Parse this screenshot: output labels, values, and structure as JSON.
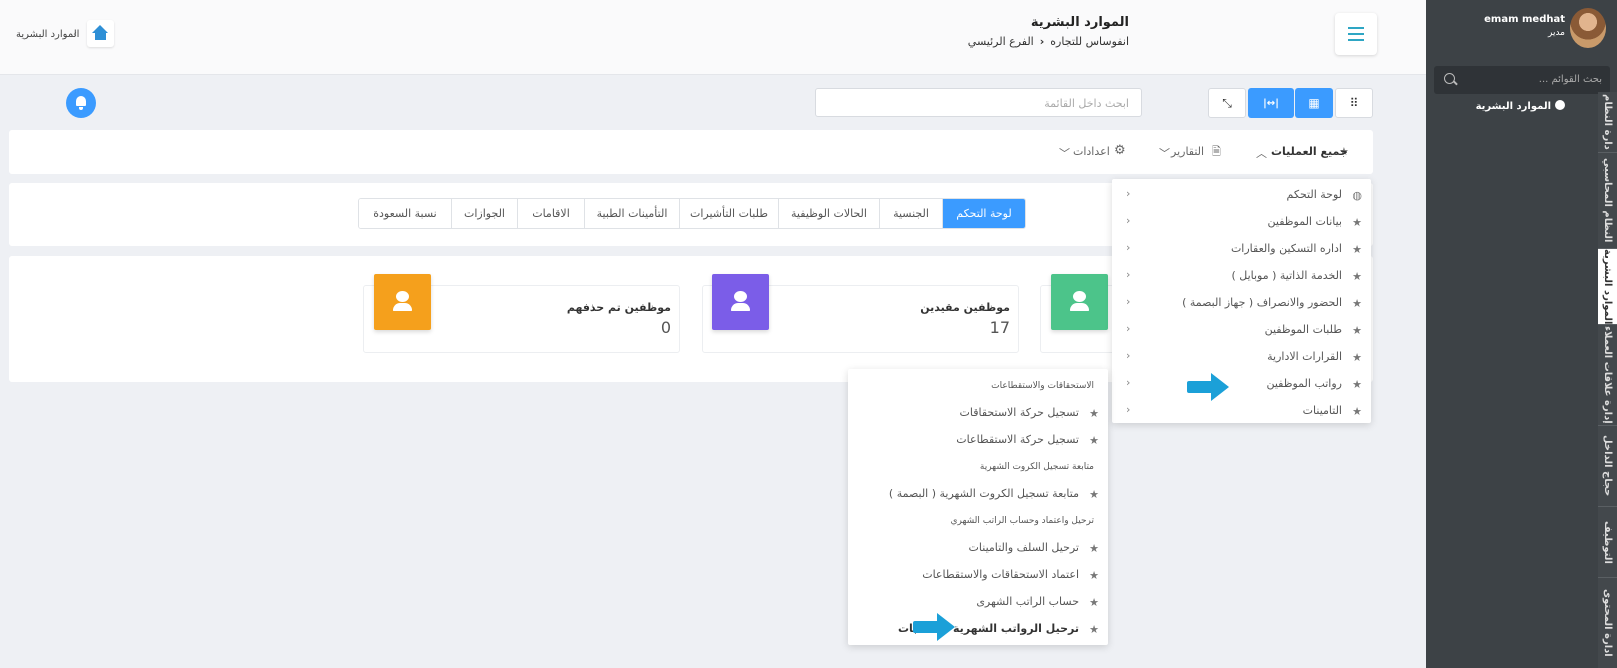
{
  "sidebar": {
    "user_name": "emam medhat",
    "user_role": "مدير",
    "search_placeholder": "بحث القوائم ...",
    "active_item": "الموارد البشرية",
    "vertical_tabs": [
      {
        "label": "دارة النظام",
        "active": false
      },
      {
        "label": "النظام المحاسبي",
        "active": false
      },
      {
        "label": "الموارد البشرية",
        "active": true
      },
      {
        "label": "إدارة علاقات العملاء",
        "active": false
      },
      {
        "label": "حجاج الداخل",
        "active": false
      },
      {
        "label": "التوظيف",
        "active": false
      },
      {
        "label": "ادارة المحتوى",
        "active": false
      }
    ]
  },
  "header": {
    "title": "الموارد البشرية",
    "breadcrumb": [
      "انفوساس للتجاره",
      "الفرع الرئيسي"
    ],
    "left_breadcrumb": "الموارد البشرية"
  },
  "toolbar": {
    "search_placeholder": "ابحث داخل القائمة"
  },
  "ops_bar": {
    "all_operations": "جميع العمليات",
    "reports": "التقارير",
    "settings": "اعدادات"
  },
  "tabs": [
    {
      "label": "لوحة التحكم",
      "active": true
    },
    {
      "label": "الجنسية",
      "active": false
    },
    {
      "label": "الحالات الوظيفية",
      "active": false
    },
    {
      "label": "طلبات التأشيرات",
      "active": false
    },
    {
      "label": "التأمينات الطبية",
      "active": false
    },
    {
      "label": "الاقامات",
      "active": false
    },
    {
      "label": "الجوازات",
      "active": false
    },
    {
      "label": "نسبة السعودة",
      "active": false
    }
  ],
  "stats": [
    {
      "label": "موظفين مقيدين",
      "value": "17",
      "color": "#7b5de8"
    },
    {
      "label": "موظفين تم حذفهم",
      "value": "0",
      "color": "#f5a01c"
    },
    {
      "label": "",
      "value": "",
      "color": "#4cc48a"
    }
  ],
  "menu_main": [
    {
      "label": "لوحة التحكم",
      "icon": "globe-icon"
    },
    {
      "label": "بيانات الموظفين",
      "icon": "star-icon"
    },
    {
      "label": "اداره التسكين والعقارات",
      "icon": "star-icon"
    },
    {
      "label": "الخدمة الذاتية ( موبايل )",
      "icon": "star-icon"
    },
    {
      "label": "الحضور والانصراف ( جهاز البصمة )",
      "icon": "star-icon"
    },
    {
      "label": "طلبات الموظفين",
      "icon": "star-icon"
    },
    {
      "label": "القرارات الادارية",
      "icon": "star-icon"
    },
    {
      "label": "رواتب الموظفين",
      "icon": "star-icon"
    },
    {
      "label": "التامينات",
      "icon": "star-icon"
    }
  ],
  "submenu": {
    "groups": [
      {
        "header": "الاستحقاقات والاستقطاعات",
        "items": [
          "تسجيل حركة الاستحقاقات",
          "تسجيل حركة الاستقطاعات"
        ]
      },
      {
        "header": "متابعة تسجيل الكروت الشهرية",
        "items": [
          "متابعة تسجيل الكروت الشهرية ( البصمة )"
        ]
      },
      {
        "header": "ترحيل واعتماد وحساب الراتب الشهري",
        "items": [
          "ترحيل السلف والتامينات",
          "اعتماد الاستحقاقات والاستقطاعات",
          "حساب الراتب الشهرى",
          "ترحيل الرواتب الشهرية للحسابات"
        ]
      }
    ]
  },
  "colors": {
    "accent": "#3b9bff",
    "sidebar": "#3d4246",
    "arrow": "#1ba0d8"
  }
}
